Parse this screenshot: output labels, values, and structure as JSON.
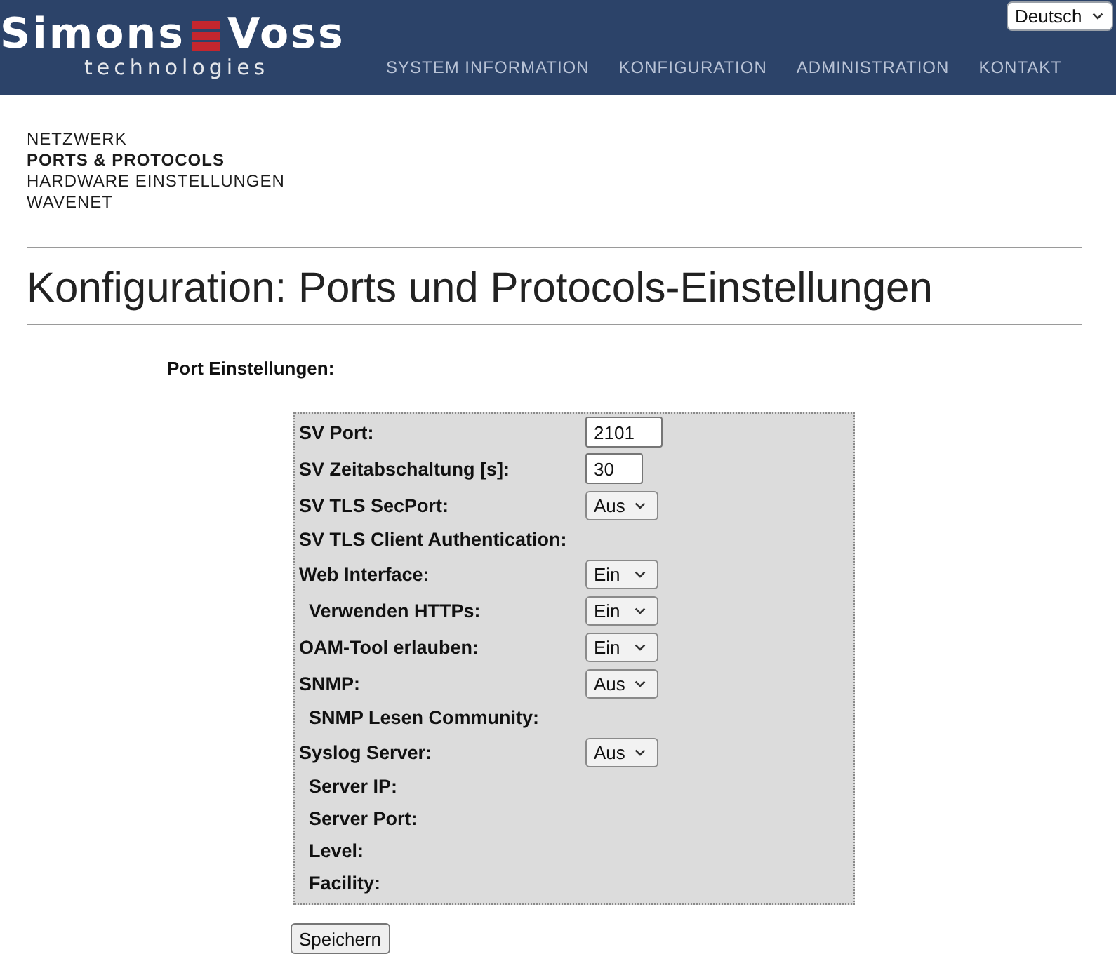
{
  "header": {
    "logo": {
      "word_left": "Simons",
      "word_right": "Voss",
      "tagline": "technologies"
    },
    "nav": [
      {
        "label": "SYSTEM INFORMATION"
      },
      {
        "label": "KONFIGURATION"
      },
      {
        "label": "ADMINISTRATION"
      },
      {
        "label": "KONTAKT"
      }
    ],
    "language": {
      "value": "Deutsch"
    }
  },
  "subnav": [
    {
      "label": "NETZWERK",
      "selected": false
    },
    {
      "label": "PORTS & PROTOCOLS",
      "selected": true
    },
    {
      "label": "HARDWARE EINSTELLUNGEN",
      "selected": false
    },
    {
      "label": "WAVENET",
      "selected": false
    }
  ],
  "title": "Konfiguration: Ports und Protocols-Einstellungen",
  "section_label": "Port Einstellungen:",
  "settings": [
    {
      "label": "SV Port:",
      "kind": "input",
      "value": "2101"
    },
    {
      "label": "SV Zeitabschaltung [s]:",
      "kind": "input",
      "value": "30"
    },
    {
      "label": "SV TLS SecPort:",
      "kind": "select",
      "value": "Aus"
    },
    {
      "label": "SV TLS Client Authentication:",
      "kind": "label"
    },
    {
      "label": "Web Interface:",
      "kind": "select",
      "value": "Ein",
      "children": [
        {
          "label": "Verwenden HTTPs:",
          "kind": "select",
          "value": "Ein"
        }
      ]
    },
    {
      "label": "OAM-Tool erlauben:",
      "kind": "select",
      "value": "Ein"
    },
    {
      "label": "SNMP:",
      "kind": "select",
      "value": "Aus",
      "children": [
        {
          "label": "SNMP Lesen Community:",
          "kind": "label"
        }
      ]
    },
    {
      "label": "Syslog Server:",
      "kind": "select",
      "value": "Aus",
      "children": [
        {
          "label": "Server IP:",
          "kind": "label"
        },
        {
          "label": "Server Port:",
          "kind": "label"
        },
        {
          "label": "Level:",
          "kind": "label"
        },
        {
          "label": "Facility:",
          "kind": "label"
        }
      ]
    }
  ],
  "save_button": "Speichern"
}
